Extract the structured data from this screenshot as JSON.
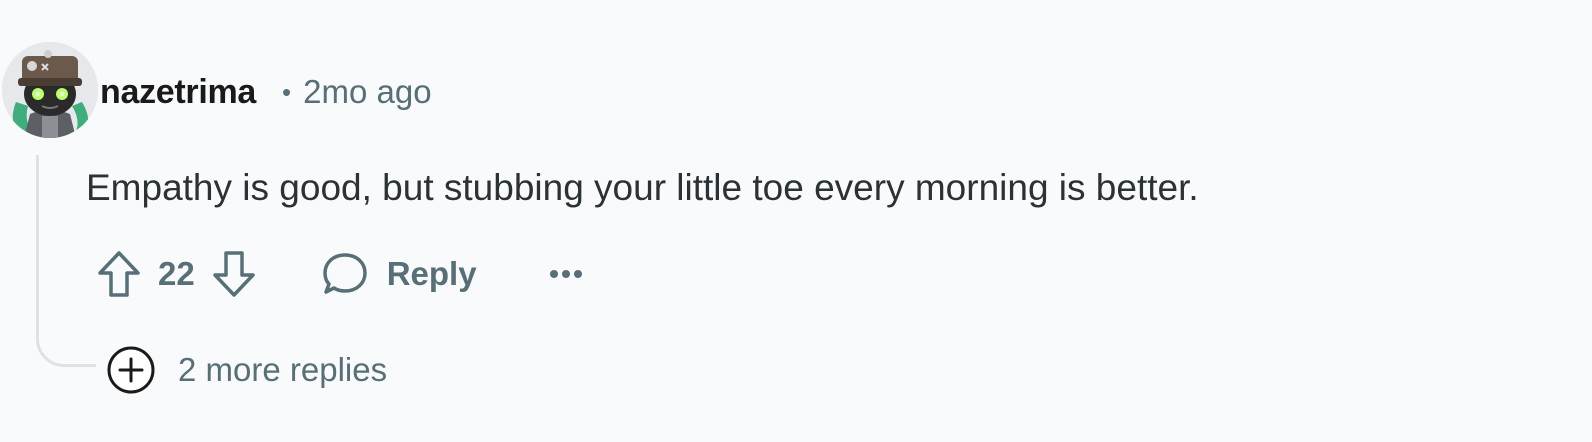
{
  "comment": {
    "username": "nazetrima",
    "separator": "•",
    "timestamp": "2mo ago",
    "body": "Empathy is good, but stubbing your little toe every morning is better.",
    "avatar_icon": "robot-avatar-icon"
  },
  "actions": {
    "upvote_icon": "arrow-up-icon",
    "vote_count": "22",
    "downvote_icon": "arrow-down-icon",
    "reply_icon": "speech-bubble-icon",
    "reply_label": "Reply",
    "more_icon": "ellipsis-icon"
  },
  "replies": {
    "expand_icon": "plus-circle-icon",
    "label": "2 more replies"
  },
  "colors": {
    "background": "#f9fafb",
    "text_primary": "#1a1a1b",
    "text_secondary": "#576f76",
    "thread_line": "#dfe2e5"
  }
}
